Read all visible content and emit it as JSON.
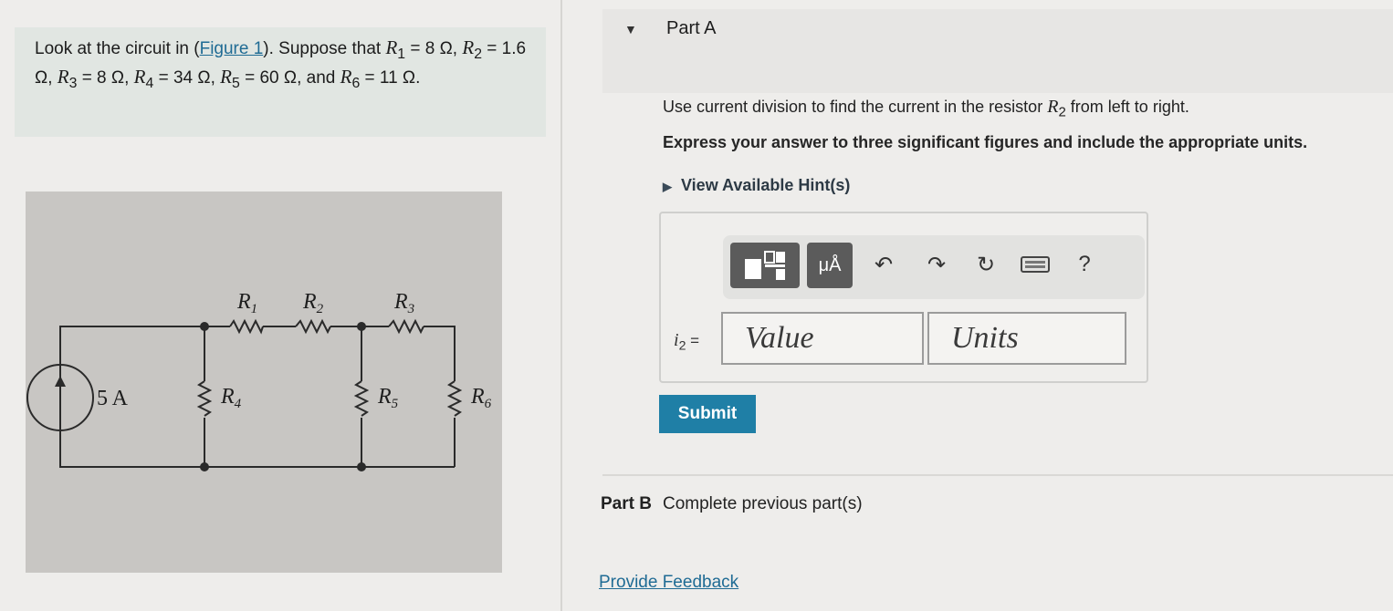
{
  "problem": {
    "text_1": "Look at the circuit in (",
    "figure_link": "Figure 1",
    "text_2": "). Suppose that",
    "values": [
      {
        "sym": "R",
        "sub": "1",
        "val": "= 8 Ω,"
      },
      {
        "sym": "R",
        "sub": "2",
        "val": "= 1.6 Ω,"
      },
      {
        "sym": "R",
        "sub": "3",
        "val": "= 8 Ω,"
      },
      {
        "sym": "R",
        "sub": "4",
        "val": "= 34 Ω,"
      },
      {
        "sym": "R",
        "sub": "5",
        "val": "= 60 Ω, and"
      },
      {
        "sym": "R",
        "sub": "6",
        "val": "= 11 Ω."
      }
    ]
  },
  "circuit": {
    "source_label": "5 A",
    "r1": "R",
    "r1_sub": "1",
    "r2": "R",
    "r2_sub": "2",
    "r3": "R",
    "r3_sub": "3",
    "r4": "R",
    "r4_sub": "4",
    "r5": "R",
    "r5_sub": "5",
    "r6": "R",
    "r6_sub": "6"
  },
  "partA": {
    "toggle_icon": "▼",
    "title": "Part A",
    "instruction_pre": "Use current division to find the current in the resistor",
    "instruction_sym": "R",
    "instruction_sub": "2",
    "instruction_post": "from left to right.",
    "express": "Express your answer to three significant figures and include the appropriate units.",
    "hints_icon": "▶",
    "hints_label": "View Available Hint(s)"
  },
  "toolbar": {
    "units_label": "μÅ",
    "undo_icon": "↶",
    "redo_icon": "↷",
    "reset_icon": "↻",
    "help_label": "?"
  },
  "answer": {
    "var": "i",
    "var_sub": "2",
    "eq": "=",
    "value_placeholder": "Value",
    "units_placeholder": "Units"
  },
  "submit_label": "Submit",
  "partB": {
    "title": "Part B",
    "status": "Complete previous part(s)"
  },
  "feedback_label": "Provide Feedback",
  "colors": {
    "accent": "#1f7fa6",
    "link": "#1f6b94",
    "problem_bg": "#e1e6e2"
  }
}
